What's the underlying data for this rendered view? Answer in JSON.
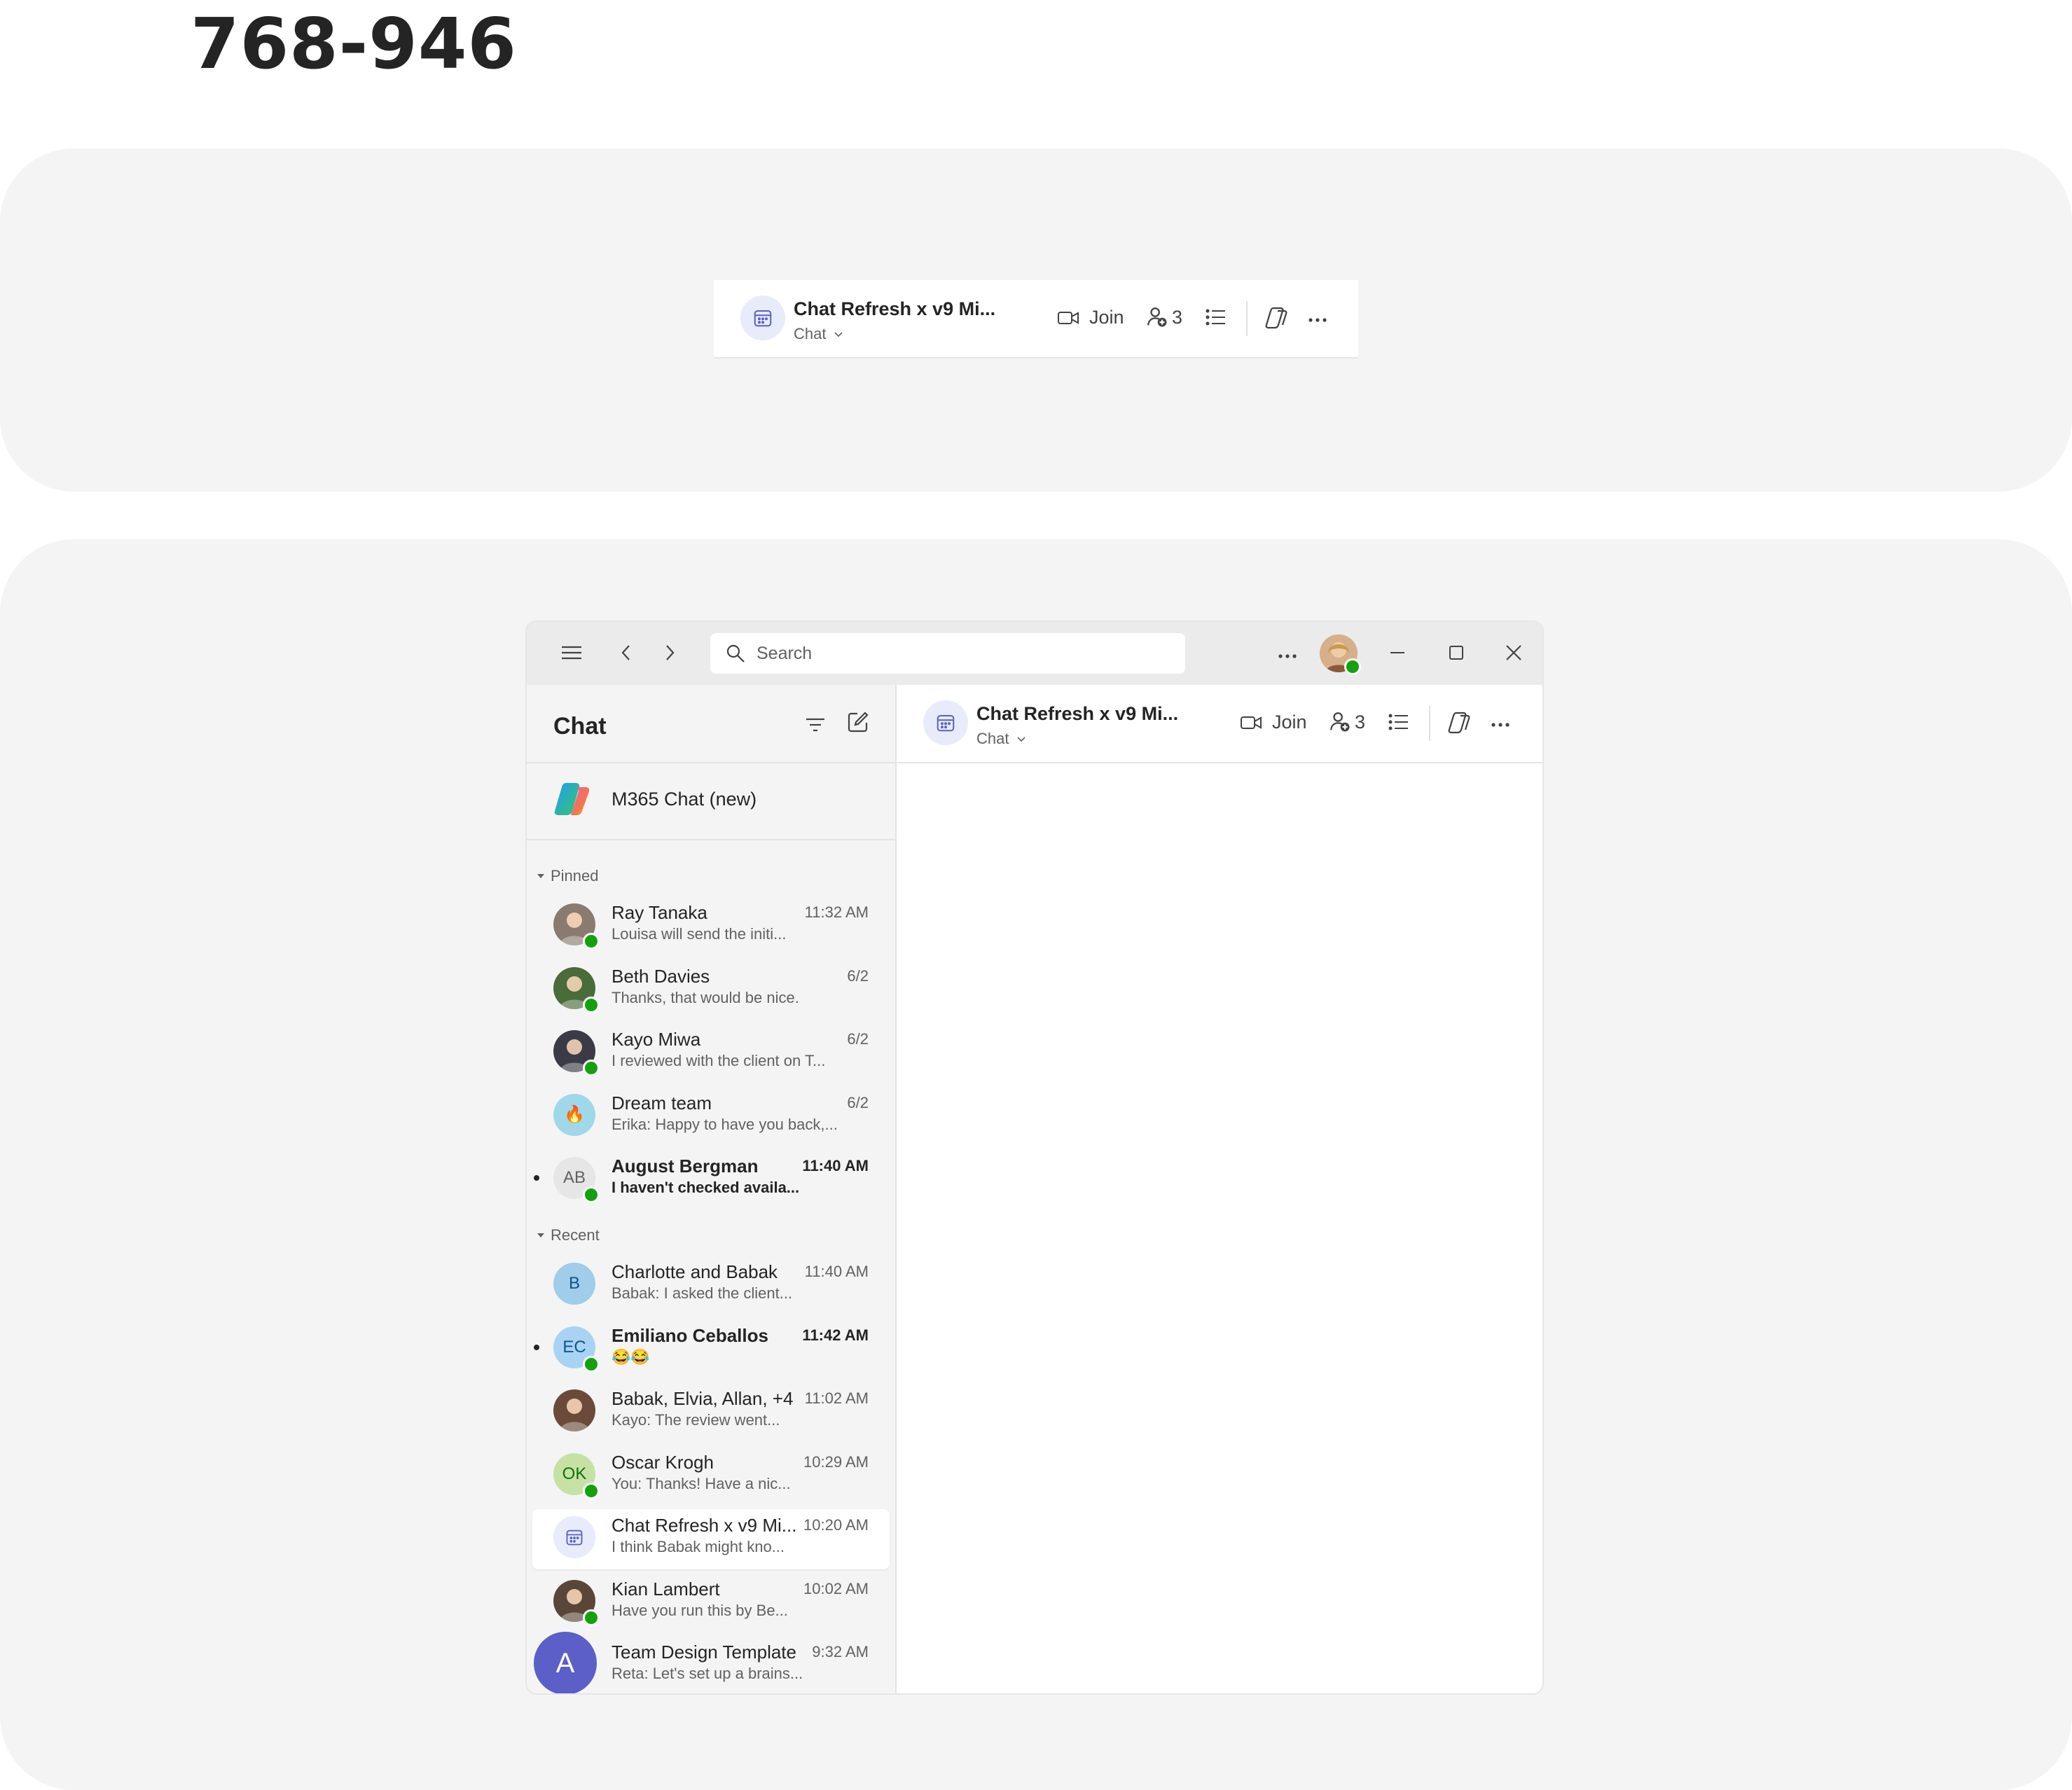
{
  "page": {
    "heading": "768-946"
  },
  "chat_header": {
    "title": "Chat Refresh x v9 Mi...",
    "subtitle": "Chat",
    "join_label": "Join",
    "participant_count": "3"
  },
  "titlebar": {
    "search_placeholder": "Search"
  },
  "sidebar": {
    "title": "Chat",
    "copilot_label": "M365 Chat (new)",
    "sections": {
      "pinned": "Pinned",
      "recent": "Recent"
    },
    "pinned": [
      {
        "name": "Ray Tanaka",
        "preview": "Louisa will send the initi...",
        "time": "11:32 AM",
        "initials": "",
        "avatar_color": "#8a7b70",
        "presence": true,
        "unread": false
      },
      {
        "name": "Beth Davies",
        "preview": "Thanks, that would be nice.",
        "time": "6/2",
        "initials": "",
        "avatar_color": "#4a6b3a",
        "presence": true,
        "unread": false
      },
      {
        "name": "Kayo Miwa",
        "preview": "I reviewed with the client on T...",
        "time": "6/2",
        "initials": "",
        "avatar_color": "#3b3b48",
        "presence": true,
        "unread": false
      },
      {
        "name": "Dream team",
        "preview": "Erika: Happy to have you back,...",
        "time": "6/2",
        "initials": "🔥",
        "avatar_color": "#9fd8e8",
        "presence": false,
        "unread": false
      },
      {
        "name": "August Bergman",
        "preview": "I haven't checked availa...",
        "time": "11:40 AM",
        "initials": "AB",
        "avatar_color": "#e6e6e6",
        "presence": true,
        "unread": true
      }
    ],
    "recent": [
      {
        "name": "Charlotte and Babak",
        "preview": "Babak: I asked the client...",
        "time": "11:40 AM",
        "initials": "B",
        "avatar_color": "#9fcdea",
        "presence": false,
        "unread": false
      },
      {
        "name": "Emiliano Ceballos",
        "preview": "😂😂",
        "time": "11:42 AM",
        "initials": "EC",
        "avatar_color": "#a9d3f2",
        "presence": true,
        "unread": true
      },
      {
        "name": "Babak, Elvia, Allan, +4",
        "preview": "Kayo: The review went...",
        "time": "11:02 AM",
        "initials": "",
        "avatar_color": "#6b4a3a",
        "presence": false,
        "unread": false
      },
      {
        "name": "Oscar Krogh",
        "preview": "You: Thanks! Have a nic...",
        "time": "10:29 AM",
        "initials": "OK",
        "avatar_color": "#c7e1a4",
        "presence": true,
        "unread": false
      },
      {
        "name": "Chat Refresh x v9 Mi...",
        "preview": "I think Babak might kno...",
        "time": "10:20 AM",
        "initials": "",
        "avatar_color": "#e8ebfa",
        "presence": false,
        "unread": false,
        "selected": true
      },
      {
        "name": "Kian Lambert",
        "preview": "Have you run this by Be...",
        "time": "10:02 AM",
        "initials": "",
        "avatar_color": "#5a4638",
        "presence": true,
        "unread": false
      },
      {
        "name": "Team Design Template",
        "preview": "Reta: Let's set up a brains...",
        "time": "9:32 AM",
        "initials": "A",
        "avatar_color": "#5b5fc7",
        "presence": false,
        "unread": false
      }
    ]
  },
  "colors": {
    "accent": "#5b5fc7",
    "presence_available": "#13a10e",
    "panel": "#f4f4f4"
  }
}
